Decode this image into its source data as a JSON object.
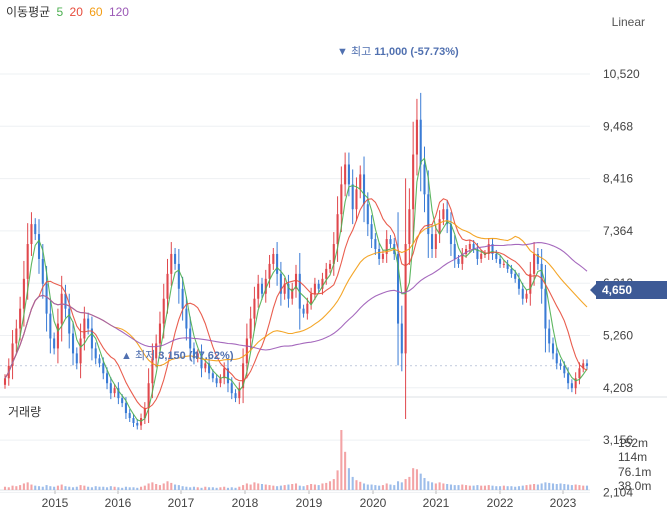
{
  "legend": {
    "title": "이동평균",
    "items": [
      {
        "label": "5",
        "color": "#e74c3c"
      },
      {
        "label": "20",
        "color": "#4caf50"
      },
      {
        "label": "60",
        "color": "#f39c12"
      },
      {
        "label": "120",
        "color": "#9b59b6"
      }
    ]
  },
  "scale_button": "Linear",
  "current_price": "4,650",
  "volume_title": "거래량",
  "annotations": {
    "high": {
      "label": "최고",
      "value": "11,000 (-57.73%)"
    },
    "low": {
      "label": "최저",
      "value": "3,150 (47.62%)"
    }
  },
  "chart_data": {
    "type": "candlestick",
    "price_ticks": [
      "10,520",
      "9,468",
      "8,416",
      "7,364",
      "6,312",
      "5,260",
      "4,208",
      "3,156",
      "2,104"
    ],
    "volume_ticks": [
      "152m",
      "114m",
      "76.1m",
      "38.0m"
    ],
    "x_labels": [
      "2015",
      "2016",
      "2017",
      "2018",
      "2019",
      "2020",
      "2021",
      "2022",
      "2023"
    ],
    "colors": {
      "up": "#e0474c",
      "down": "#3a7bd5",
      "ma5": "#e74c3c",
      "ma20": "#4caf50",
      "ma60": "#f39c12",
      "ma120": "#9b59b6"
    },
    "closes": [
      4400,
      4650,
      5100,
      5400,
      5800,
      6400,
      7100,
      7500,
      7300,
      6800,
      6300,
      5700,
      5200,
      5000,
      5500,
      6100,
      5800,
      5300,
      4900,
      4700,
      5200,
      5600,
      5400,
      5000,
      4800,
      4700,
      4500,
      4300,
      4100,
      4200,
      4000,
      3900,
      3700,
      3600,
      3500,
      3450,
      3600,
      3800,
      4300,
      4800,
      5100,
      5500,
      6000,
      6500,
      6900,
      6700,
      6200,
      5800,
      5400,
      5000,
      4800,
      4900,
      4600,
      4700,
      4500,
      4400,
      4300,
      4400,
      4600,
      4300,
      4100,
      4000,
      4200,
      4700,
      5200,
      5600,
      6000,
      6300,
      6100,
      6400,
      6700,
      6900,
      6500,
      6100,
      6300,
      6000,
      6200,
      6500,
      5800,
      5700,
      5900,
      6100,
      6300,
      6200,
      6400,
      6600,
      6700,
      7100,
      7700,
      8300,
      8700,
      8300,
      7800,
      8200,
      8500,
      7900,
      7500,
      7200,
      7000,
      6800,
      6900,
      7200,
      7100,
      6900,
      5500,
      4900,
      7100,
      7800,
      8900,
      9600,
      8700,
      8100,
      7300,
      7000,
      7300,
      7600,
      7800,
      7500,
      7100,
      6800,
      6700,
      6900,
      7000,
      7100,
      7000,
      6800,
      6900,
      6900,
      7100,
      6900,
      6800,
      6700,
      6700,
      6600,
      6500,
      6400,
      6200,
      6000,
      6100,
      6500,
      6900,
      6700,
      6200,
      5400,
      5100,
      4900,
      4700,
      4650,
      4500,
      4300,
      4200,
      4400,
      4600,
      4700,
      4650
    ],
    "volumes": [
      6,
      5,
      8,
      7,
      9,
      12,
      14,
      10,
      8,
      7,
      6,
      9,
      7,
      6,
      8,
      10,
      7,
      6,
      5,
      6,
      9,
      8,
      6,
      5,
      7,
      6,
      6,
      5,
      7,
      6,
      5,
      4,
      6,
      5,
      5,
      4,
      6,
      8,
      12,
      14,
      11,
      9,
      12,
      16,
      13,
      10,
      9,
      7,
      6,
      5,
      6,
      5,
      4,
      6,
      5,
      5,
      4,
      5,
      6,
      4,
      5,
      4,
      6,
      9,
      12,
      10,
      14,
      12,
      11,
      10,
      9,
      8,
      7,
      8,
      9,
      10,
      11,
      12,
      8,
      7,
      9,
      11,
      10,
      9,
      12,
      13,
      16,
      20,
      36,
      110,
      70,
      40,
      24,
      18,
      15,
      12,
      10,
      10,
      9,
      8,
      9,
      12,
      10,
      9,
      16,
      14,
      20,
      24,
      40,
      38,
      30,
      22,
      16,
      14,
      12,
      14,
      12,
      11,
      10,
      9,
      9,
      10,
      9,
      8,
      8,
      9,
      8,
      8,
      9,
      8,
      7,
      7,
      8,
      7,
      7,
      6,
      7,
      8,
      9,
      10,
      11,
      10,
      12,
      14,
      13,
      12,
      11,
      12,
      11,
      10,
      9,
      10,
      9,
      8,
      8,
      9,
      10,
      9,
      8
    ]
  }
}
